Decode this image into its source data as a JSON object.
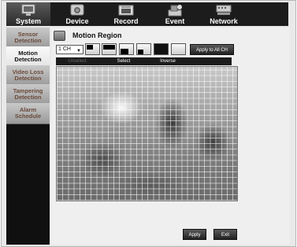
{
  "tabs": [
    {
      "label": "System",
      "icon": "system-icon",
      "active": true
    },
    {
      "label": "Device",
      "icon": "device-icon",
      "active": false
    },
    {
      "label": "Record",
      "icon": "record-icon",
      "active": false
    },
    {
      "label": "Event",
      "icon": "event-icon",
      "active": false
    },
    {
      "label": "Network",
      "icon": "network-icon",
      "active": false
    }
  ],
  "sidebar": {
    "items": [
      {
        "line1": "Sensor",
        "line2": "Detection",
        "active": false
      },
      {
        "line1": "Motion",
        "line2": "Detection",
        "active": true
      },
      {
        "line1": "Video Loss",
        "line2": "Detection",
        "active": false
      },
      {
        "line1": "Tampering",
        "line2": "Detection",
        "active": false
      },
      {
        "line1": "Alarm",
        "line2": "Schedule",
        "active": false
      }
    ]
  },
  "main": {
    "title": "Motion Region",
    "channel": "1 CH",
    "apply_all_label": "Apply to All CH",
    "modes": [
      "Unselect",
      "Select",
      "Inverse"
    ],
    "apply_label": "Apply",
    "exit_label": "Exit"
  },
  "colors": {
    "accent_dark": "#1c1c1c",
    "sidebar_text": "#6b4a3a"
  }
}
